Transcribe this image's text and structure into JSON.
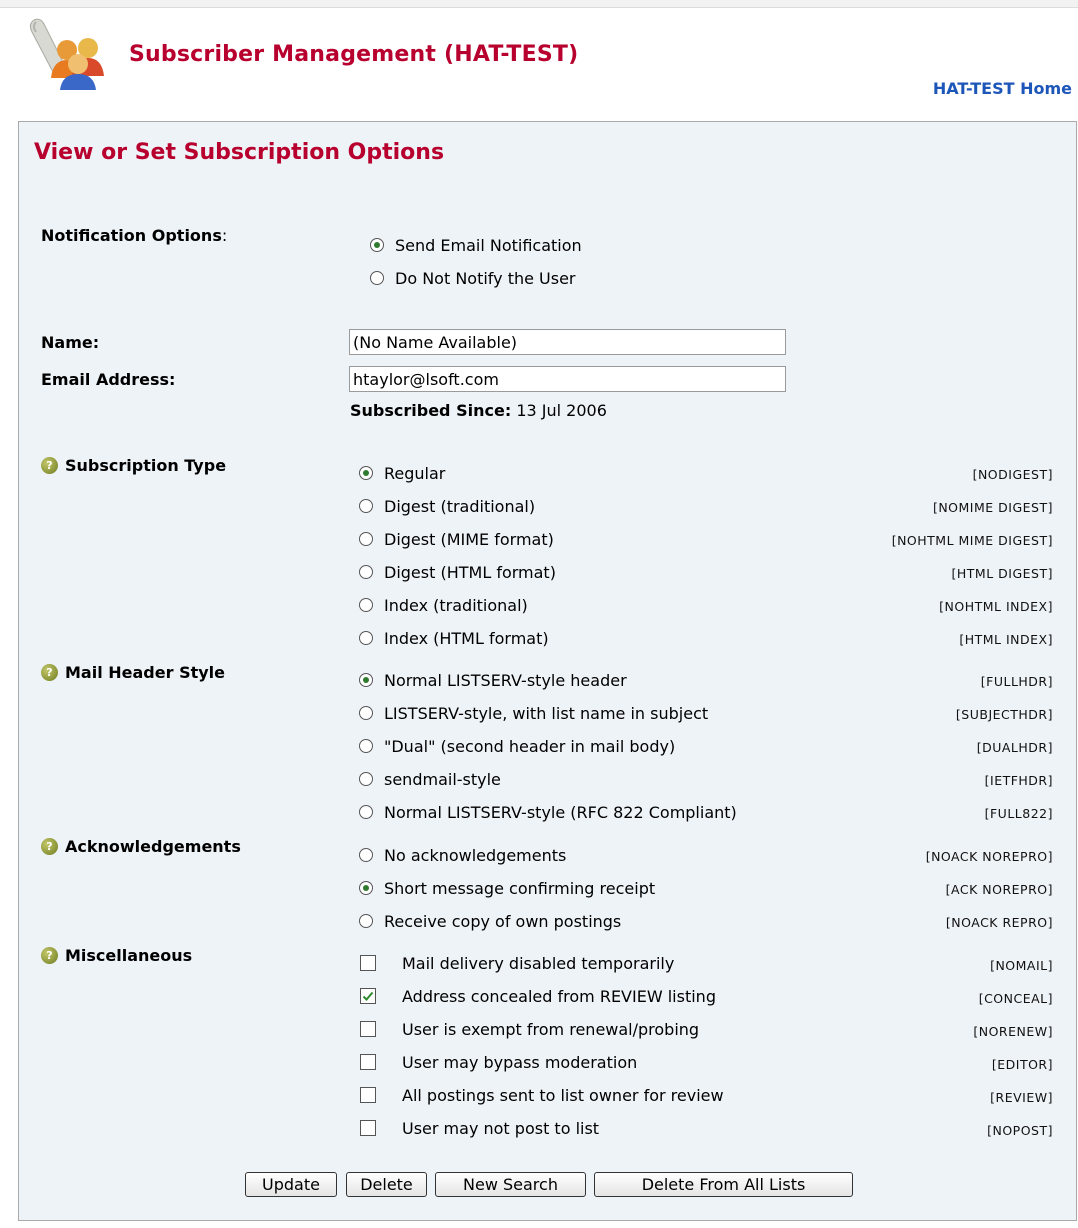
{
  "header": {
    "title": "Subscriber Management (HAT-TEST)",
    "home_link": "HAT-TEST Home"
  },
  "section_title": "View or Set Subscription Options",
  "notification": {
    "label": "Notification Options",
    "options": [
      {
        "label": "Send Email Notification",
        "selected": true
      },
      {
        "label": "Do Not Notify the User",
        "selected": false
      }
    ]
  },
  "name": {
    "label": "Name:",
    "value": "(No Name Available)"
  },
  "email": {
    "label": "Email Address:",
    "value": "htaylor@lsoft.com"
  },
  "subscribed_since": {
    "label": "Subscribed Since:",
    "value": "13 Jul 2006"
  },
  "subscription_type": {
    "label": "Subscription Type",
    "options": [
      {
        "label": "Regular",
        "code": "[NODIGEST]",
        "selected": true
      },
      {
        "label": "Digest (traditional)",
        "code": "[NOMIME DIGEST]",
        "selected": false
      },
      {
        "label": "Digest (MIME format)",
        "code": "[NOHTML MIME DIGEST]",
        "selected": false
      },
      {
        "label": "Digest (HTML format)",
        "code": "[HTML DIGEST]",
        "selected": false
      },
      {
        "label": "Index (traditional)",
        "code": "[NOHTML INDEX]",
        "selected": false
      },
      {
        "label": "Index (HTML format)",
        "code": "[HTML INDEX]",
        "selected": false
      }
    ]
  },
  "mail_header_style": {
    "label": "Mail Header Style",
    "options": [
      {
        "label": "Normal LISTSERV-style header",
        "code": "[FULLHDR]",
        "selected": true
      },
      {
        "label": "LISTSERV-style, with list name in subject",
        "code": "[SUBJECTHDR]",
        "selected": false
      },
      {
        "label": "\"Dual\" (second header in mail body)",
        "code": "[DUALHDR]",
        "selected": false
      },
      {
        "label": "sendmail-style",
        "code": "[IETFHDR]",
        "selected": false
      },
      {
        "label": "Normal LISTSERV-style (RFC 822 Compliant)",
        "code": "[FULL822]",
        "selected": false
      }
    ]
  },
  "acknowledgements": {
    "label": "Acknowledgements",
    "options": [
      {
        "label": "No acknowledgements",
        "code": "[NOACK NOREPRO]",
        "selected": false
      },
      {
        "label": "Short message confirming receipt",
        "code": "[ACK NOREPRO]",
        "selected": true
      },
      {
        "label": "Receive copy of own postings",
        "code": "[NOACK REPRO]",
        "selected": false
      }
    ]
  },
  "miscellaneous": {
    "label": "Miscellaneous",
    "options": [
      {
        "label": "Mail delivery disabled temporarily",
        "code": "[NOMAIL]",
        "checked": false
      },
      {
        "label": "Address concealed from REVIEW listing",
        "code": "[CONCEAL]",
        "checked": true
      },
      {
        "label": "User is exempt from renewal/probing",
        "code": "[NORENEW]",
        "checked": false
      },
      {
        "label": "User may bypass moderation",
        "code": "[EDITOR]",
        "checked": false
      },
      {
        "label": "All postings sent to list owner for review",
        "code": "[REVIEW]",
        "checked": false
      },
      {
        "label": "User may not post to list",
        "code": "[NOPOST]",
        "checked": false
      }
    ]
  },
  "buttons": {
    "update": "Update",
    "delete": "Delete",
    "new_search": "New Search",
    "delete_all": "Delete From All Lists"
  },
  "colors": {
    "title_red": "#b8002e",
    "link_blue": "#1c56b8",
    "panel_bg": "#eef3f8"
  }
}
